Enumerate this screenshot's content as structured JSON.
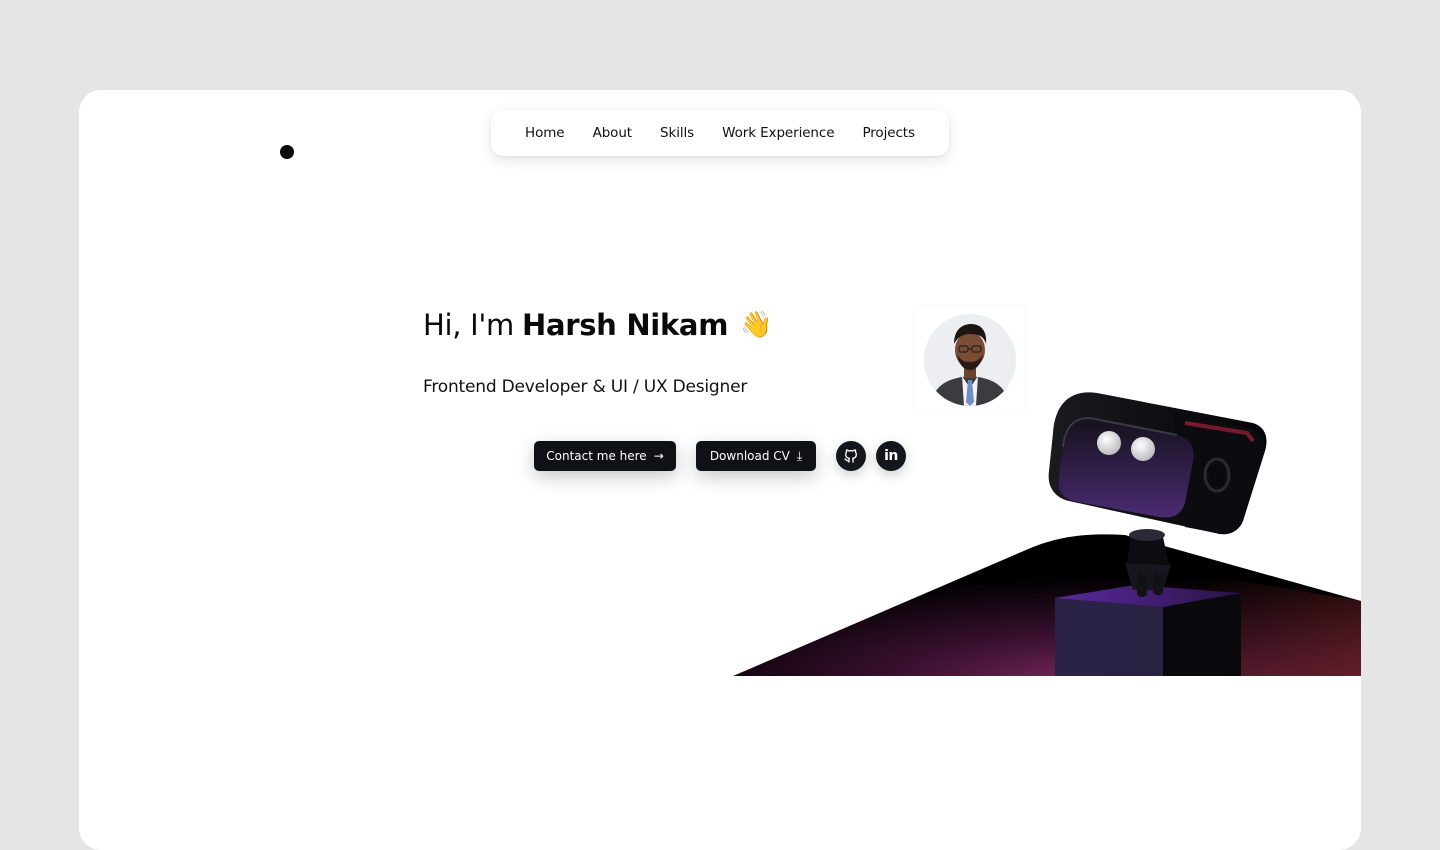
{
  "nav": {
    "items": [
      {
        "label": "Home"
      },
      {
        "label": "About"
      },
      {
        "label": "Skills"
      },
      {
        "label": "Work Experience"
      },
      {
        "label": "Projects"
      }
    ]
  },
  "hero": {
    "greeting": "Hi, I'm",
    "name": "Harsh Nikam",
    "wave_emoji": "👋",
    "subtitle": "Frontend Developer & UI / UX Designer"
  },
  "actions": {
    "contact_label": "Contact me here",
    "contact_icon": "→",
    "cv_label": "Download CV",
    "cv_icon": "⤓"
  },
  "social": {
    "github_icon": "github-icon",
    "linkedin_text": "in"
  },
  "colors": {
    "page_background": "#e5e5e5",
    "card_background": "#ffffff",
    "button_background": "#0f1116",
    "text": "#0a0a0a",
    "accent_purple": "#3a1a5c",
    "accent_red": "#8a1f33"
  },
  "icons": [
    "cursor-dot",
    "wave-icon",
    "arrow-right-icon",
    "download-icon",
    "github-icon",
    "linkedin-icon",
    "robot-illustration"
  ]
}
